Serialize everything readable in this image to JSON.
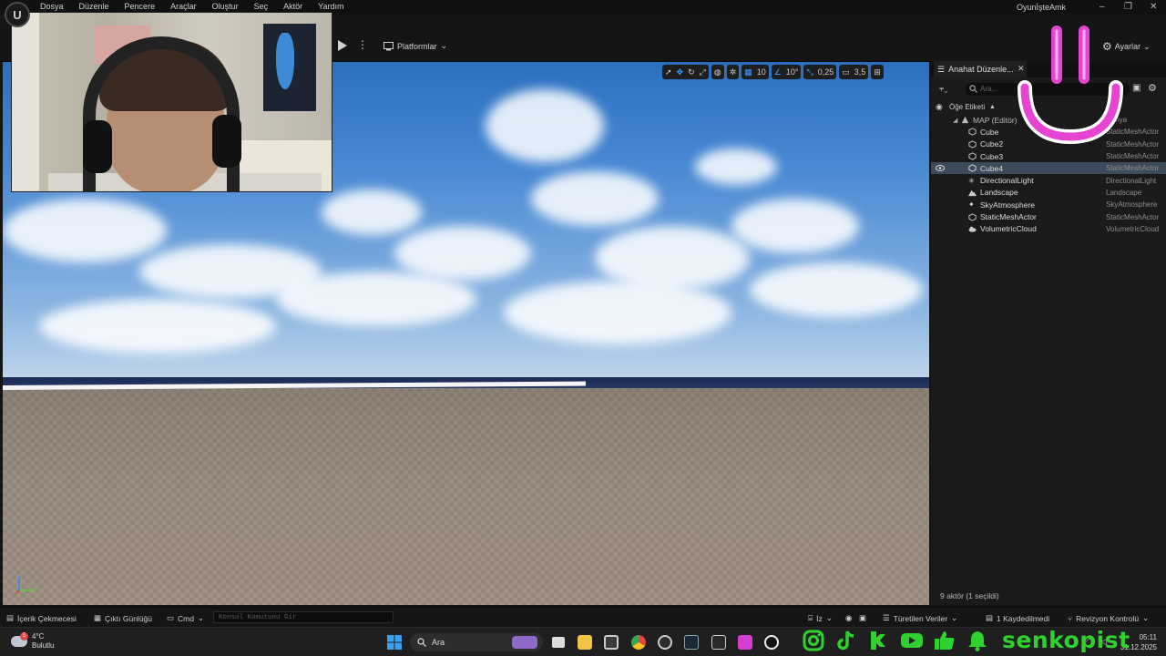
{
  "menubar": {
    "items": [
      "Dosya",
      "Düzenle",
      "Pencere",
      "Araçlar",
      "Oluştur",
      "Seç",
      "Aktör",
      "Yardım"
    ],
    "project_title": "OyunİşteAmk"
  },
  "toolbar": {
    "platforms_label": "Platformlar",
    "settings_label": "Ayarlar"
  },
  "viewport_toolbar": {
    "grid_snap": "10",
    "rotation_snap": "10°",
    "scale_snap": "0,25",
    "camera_speed": "3,5"
  },
  "outliner": {
    "tab_label": "Anahat Düzenle...",
    "search_placeholder": "Ara...",
    "column_label": "Öğe Etiketi",
    "map_label": "MAP (Editör)",
    "map_type": "Dünya",
    "rows": [
      {
        "name": "Cube",
        "type": "StaticMeshActor",
        "icon": "cube-icon"
      },
      {
        "name": "Cube2",
        "type": "StaticMeshActor",
        "icon": "cube-icon"
      },
      {
        "name": "Cube3",
        "type": "StaticMeshActor",
        "icon": "cube-icon"
      },
      {
        "name": "Cube4",
        "type": "StaticMeshActor",
        "icon": "cube-icon",
        "selected": true
      },
      {
        "name": "DirectionalLight",
        "type": "DirectionalLight",
        "icon": "light-icon"
      },
      {
        "name": "Landscape",
        "type": "Landscape",
        "icon": "landscape-icon"
      },
      {
        "name": "SkyAtmosphere",
        "type": "SkyAtmosphere",
        "icon": "sky-icon"
      },
      {
        "name": "StaticMeshActor",
        "type": "StaticMeshActor",
        "icon": "cube-icon"
      },
      {
        "name": "VolumetricCloud",
        "type": "VolumetricCloud",
        "icon": "cloud-icon"
      }
    ],
    "footer": "9 aktör (1 seçildi)"
  },
  "bottombar": {
    "content_drawer": "İçerik Çekmecesi",
    "output_log": "Çıktı Günlüğü",
    "cmd": "Cmd",
    "console_placeholder": "Konsol Komutunu Gir",
    "trace": "İz",
    "derived_data": "Türetilen Veriler",
    "unsaved": "1 Kaydedilmedi",
    "revision": "Revizyon Kontrolü"
  },
  "taskbar": {
    "weather_temp": "4°C",
    "weather_desc": "Bulutlu",
    "weather_badge": "5",
    "search_label": "Ara",
    "time": "05:11",
    "date": "31.12.2025"
  },
  "overlay": {
    "social_name": "senkopist"
  },
  "colors": {
    "accent_green": "#2fd12f",
    "selection": "#3d4a5a",
    "smiley_pink": "#e844d4"
  }
}
